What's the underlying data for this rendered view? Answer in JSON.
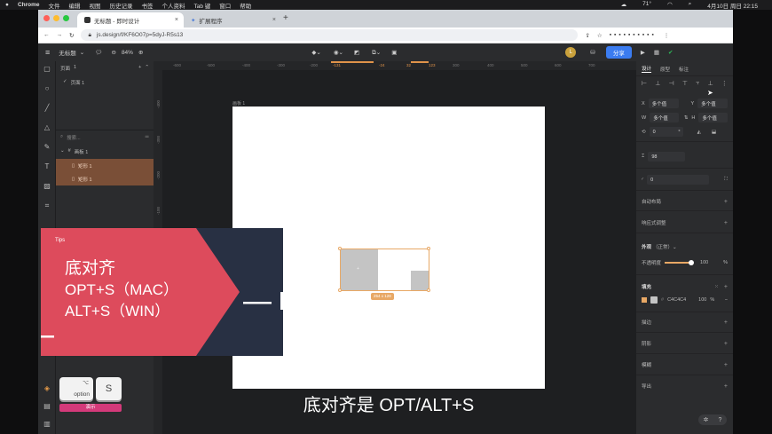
{
  "menubar": {
    "app": "Chrome",
    "items": [
      "文件",
      "编辑",
      "视图",
      "历史记录",
      "书签",
      "个人资料",
      "Tab 键",
      "窗口",
      "帮助"
    ],
    "temp": "71°",
    "datetime": "4月10日 周日 22:15"
  },
  "browser": {
    "tabs": [
      {
        "title": "无标题 - 即时设计"
      },
      {
        "title": "扩展程序"
      }
    ],
    "url": "js.design/f/KF6O07p=5dyJ-R5s13"
  },
  "toolbar": {
    "file_name": "无标题",
    "zoom": "84%",
    "share_label": "分享",
    "avatar_initial": "L"
  },
  "layers": {
    "pages_label": "页面",
    "pages_count": "1",
    "page_name": "页面 1",
    "search_placeholder": "搜索...",
    "items": [
      {
        "name": "画板 1"
      },
      {
        "name": "矩形 1"
      },
      {
        "name": "矩形 1"
      }
    ]
  },
  "ruler": {
    "top": [
      "-600",
      "-500",
      "-400",
      "-300",
      "-200",
      "-131",
      "-24",
      "32",
      "123",
      "300",
      "400",
      "500",
      "600",
      "700"
    ],
    "left": [
      "-400",
      "-300",
      "-200",
      "-100"
    ]
  },
  "canvas": {
    "artboard_label": "画板 1",
    "selection_size": "254 x 128"
  },
  "rightpanel": {
    "tabs": [
      "设计",
      "原型",
      "标注"
    ],
    "x_label": "X",
    "x_value": "多个值",
    "y_label": "Y",
    "y_value": "多个值",
    "w_label": "W",
    "w_value": "多个值",
    "h_label": "H",
    "h_value": "多个值",
    "rotation": "0",
    "rotation_unit": "°",
    "height_value": "98",
    "radius": "0",
    "auto_layout": "自动布局",
    "responsive": "响应式调整",
    "appearance_label": "外观",
    "blend_mode": "正常",
    "opacity_label": "不透明度",
    "opacity_value": "100",
    "opacity_unit": "%",
    "opacity_level": 1.0,
    "fill_label": "填充",
    "fill_hex": "C4C4C4",
    "fill_opacity": "100",
    "fill_unit": "%",
    "stroke_label": "描边",
    "shadow_label": "阴影",
    "blur_label": "模糊",
    "export_label": "导出",
    "colors": {
      "fill": "#C4C4C4",
      "accent": "#E8A865"
    }
  },
  "tips": {
    "label": "Tips",
    "line1": "底对齐",
    "line2": "OPT+S（MAC）",
    "line3": "ALT+S（WIN）",
    "colors": {
      "red": "#DD4B5C",
      "navy": "#283043"
    }
  },
  "keys": {
    "option_symbol": "⌥",
    "option_label": "option",
    "s_label": "S",
    "demo_label": "演示"
  },
  "subtitle": "底对齐是 OPT/ALT+S"
}
